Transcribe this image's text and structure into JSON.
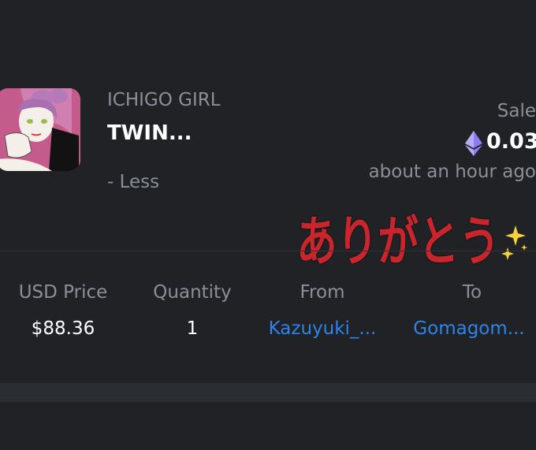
{
  "item": {
    "collection": "ICHIGO GIRL",
    "name": "TWIN...",
    "less_label": "- Less"
  },
  "sale": {
    "label": "Sale",
    "price": "0.03",
    "currency_icon": "ethereum-icon",
    "time": "about an hour ago"
  },
  "sticker": {
    "text": "ありがとう"
  },
  "details": {
    "headers": [
      "USD Price",
      "Quantity",
      "From",
      "To"
    ],
    "values": [
      "$88.36",
      "1",
      "Kazuyuki_...",
      "Gomagom..."
    ]
  },
  "colors": {
    "background": "#202225",
    "muted_text": "#8a8f98",
    "link": "#2e84e8",
    "sticker_red": "#c8262c"
  }
}
